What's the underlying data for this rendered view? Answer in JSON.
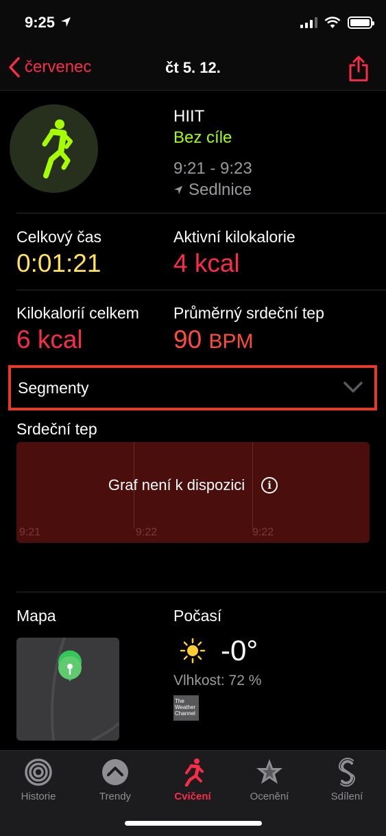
{
  "status": {
    "time": "9:25"
  },
  "nav": {
    "back_label": "červenec",
    "title": "čt 5. 12."
  },
  "workout": {
    "type": "HIIT",
    "goal": "Bez cíle",
    "time_range": "9:21 - 9:23",
    "location": "Sedlnice"
  },
  "metrics": {
    "total_time_label": "Celkový čas",
    "total_time_value": "0:01:21",
    "active_kcal_label": "Aktivní kilokalorie",
    "active_kcal_value": "4 kcal",
    "total_kcal_label": "Kilokalorií celkem",
    "total_kcal_value": "6 kcal",
    "avg_hr_label": "Průměrný srdeční tep",
    "avg_hr_value": "90",
    "avg_hr_unit": "BPM"
  },
  "segments": {
    "label": "Segmenty"
  },
  "heart_rate": {
    "label": "Srdeční tep",
    "message": "Graf není k dispozici",
    "ticks": [
      "9:21",
      "9:22",
      "9:22"
    ]
  },
  "map": {
    "label": "Mapa"
  },
  "weather": {
    "label": "Počasí",
    "temperature": "-0°",
    "humidity": "Vlhkost: 72 %",
    "provider_logo_text": "The Weather Channel"
  },
  "tabs": [
    {
      "label": "Historie",
      "icon": "history-ring-icon"
    },
    {
      "label": "Trendy",
      "icon": "trends-chevron-icon"
    },
    {
      "label": "Cvičení",
      "icon": "workout-runner-icon"
    },
    {
      "label": "Ocenění",
      "icon": "awards-star-icon"
    },
    {
      "label": "Sdílení",
      "icon": "sharing-icon"
    }
  ],
  "colors": {
    "accent": "#fa2d48",
    "goal_green": "#a6ff00",
    "time_yellow": "#ffe35a",
    "highlight_border": "#e5392a"
  }
}
